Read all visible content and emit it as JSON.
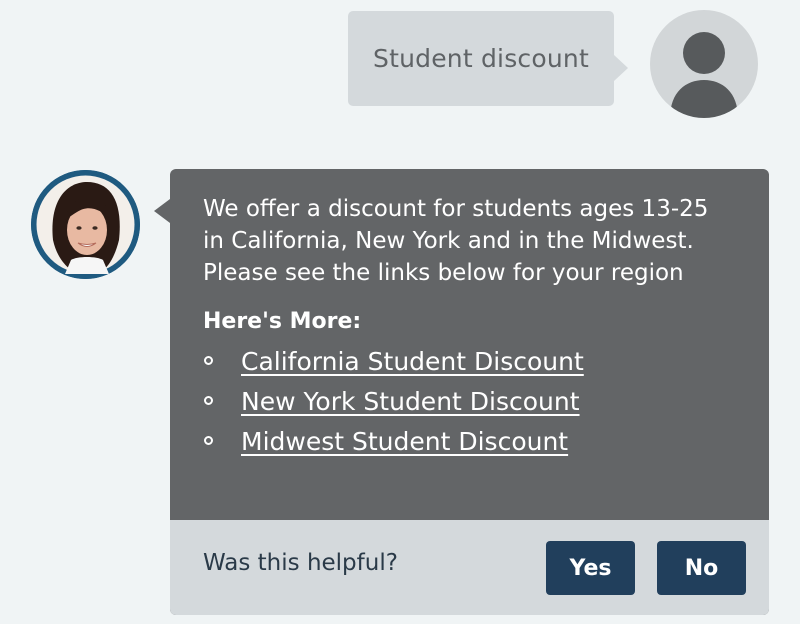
{
  "user_message": {
    "text": "Student discount",
    "avatar_icon": "user-silhouette-icon"
  },
  "agent_message": {
    "avatar": "agent-photo",
    "lines": [
      "We offer a discount for students ages 13-25",
      "in California, New York and in the Midwest.",
      "Please see the links below for your region"
    ],
    "more_heading": "Here's More:",
    "links": [
      "California Student Discount",
      "New York Student Discount",
      "Midwest Student Discount"
    ]
  },
  "feedback": {
    "question": "Was this helpful?",
    "yes_label": "Yes",
    "no_label": "No"
  },
  "colors": {
    "background": "#f0f4f5",
    "user_bubble": "#d4d9dc",
    "agent_bubble": "#636567",
    "agent_avatar_ring": "#1f5a80",
    "button": "#213f5c"
  }
}
